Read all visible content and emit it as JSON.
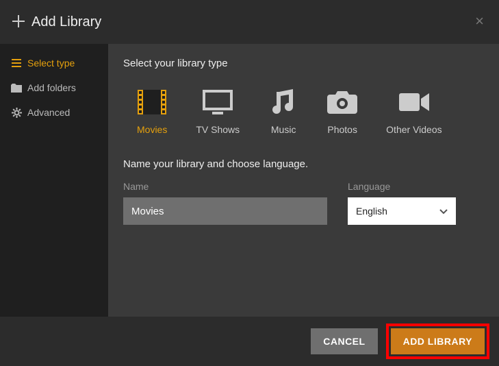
{
  "header": {
    "title": "Add Library"
  },
  "sidebar": {
    "items": [
      {
        "label": "Select type"
      },
      {
        "label": "Add folders"
      },
      {
        "label": "Advanced"
      }
    ]
  },
  "main": {
    "section_title": "Select your library type",
    "types": [
      {
        "label": "Movies"
      },
      {
        "label": "TV Shows"
      },
      {
        "label": "Music"
      },
      {
        "label": "Photos"
      },
      {
        "label": "Other Videos"
      }
    ],
    "subtext": "Name your library and choose language.",
    "name_label": "Name",
    "name_value": "Movies",
    "language_label": "Language",
    "language_value": "English"
  },
  "footer": {
    "cancel": "CANCEL",
    "add": "ADD LIBRARY"
  }
}
